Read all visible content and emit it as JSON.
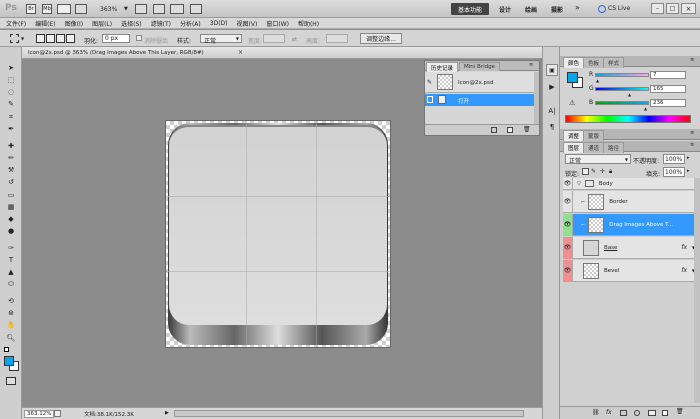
{
  "app": {
    "logo": "Ps",
    "zoom": "363%",
    "workspaces": [
      "基本功能",
      "设计",
      "绘画",
      "摄影"
    ],
    "more": "»",
    "cslive": "CS Live"
  },
  "menu": [
    "文件(F)",
    "编辑(E)",
    "图像(I)",
    "图层(L)",
    "选择(S)",
    "滤镜(T)",
    "分析(A)",
    "3D(D)",
    "视图(V)",
    "窗口(W)",
    "帮助(H)"
  ],
  "options": {
    "feather_label": "羽化:",
    "feather_value": "0 px",
    "antialias": "消除锯齿",
    "style_label": "样式:",
    "style_value": "正常",
    "width_label": "宽度:",
    "height_label": "高度:",
    "refine": "调整边缘..."
  },
  "document": {
    "tab_title": "Icon@2x.psd @ 363% (Drag Images Above This Layer, RGB/8#)",
    "tab_close": "×",
    "zoom": "363.12%",
    "doc_info": "文档:38.1K/152.3K"
  },
  "history": {
    "tabs": [
      "历史记录",
      "Mini Bridge"
    ],
    "snapshot": "Icon@2x.psd",
    "items": [
      "打开"
    ]
  },
  "color": {
    "tabs": [
      "颜色",
      "色板",
      "样式"
    ],
    "r_label": "R",
    "g_label": "G",
    "b_label": "B",
    "r": 7,
    "g": 165,
    "b": 236,
    "swatch": "#07a5ec"
  },
  "adjust_tabs": [
    "调整",
    "蒙版"
  ],
  "layers": {
    "tabs": [
      "图层",
      "通道",
      "路径"
    ],
    "blend_mode": "正常",
    "opacity_label": "不透明度:",
    "opacity": "100%",
    "lock_label": "锁定:",
    "fill_label": "填充:",
    "fill": "100%",
    "items": [
      {
        "name": "Body",
        "type": "group"
      },
      {
        "name": "Border",
        "type": "layer"
      },
      {
        "name": "Drag Images Above T...",
        "type": "layer"
      },
      {
        "name": "Base",
        "type": "layer"
      },
      {
        "name": "Bevel",
        "type": "layer"
      }
    ],
    "fx": "fx"
  },
  "colors": {
    "selection": "#3399ff",
    "accent": "#07a5ec",
    "green_eye": "#8fe08f",
    "red_eye": "#f08f8f"
  }
}
